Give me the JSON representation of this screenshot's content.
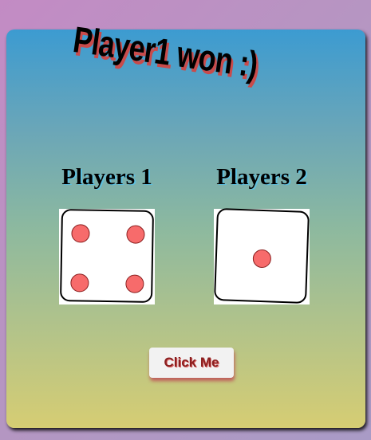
{
  "banner": {
    "text": "Player1 won :)"
  },
  "players": [
    {
      "name": "Players 1",
      "die_value": 4
    },
    {
      "name": "Players 2",
      "die_value": 1
    }
  ],
  "button": {
    "label": "Click Me"
  },
  "colors": {
    "pip": "#f76b6b",
    "banner_shadow": "#c94b4b",
    "name_shadow": "#5ec0e0",
    "button_text": "#8a1f1f"
  }
}
